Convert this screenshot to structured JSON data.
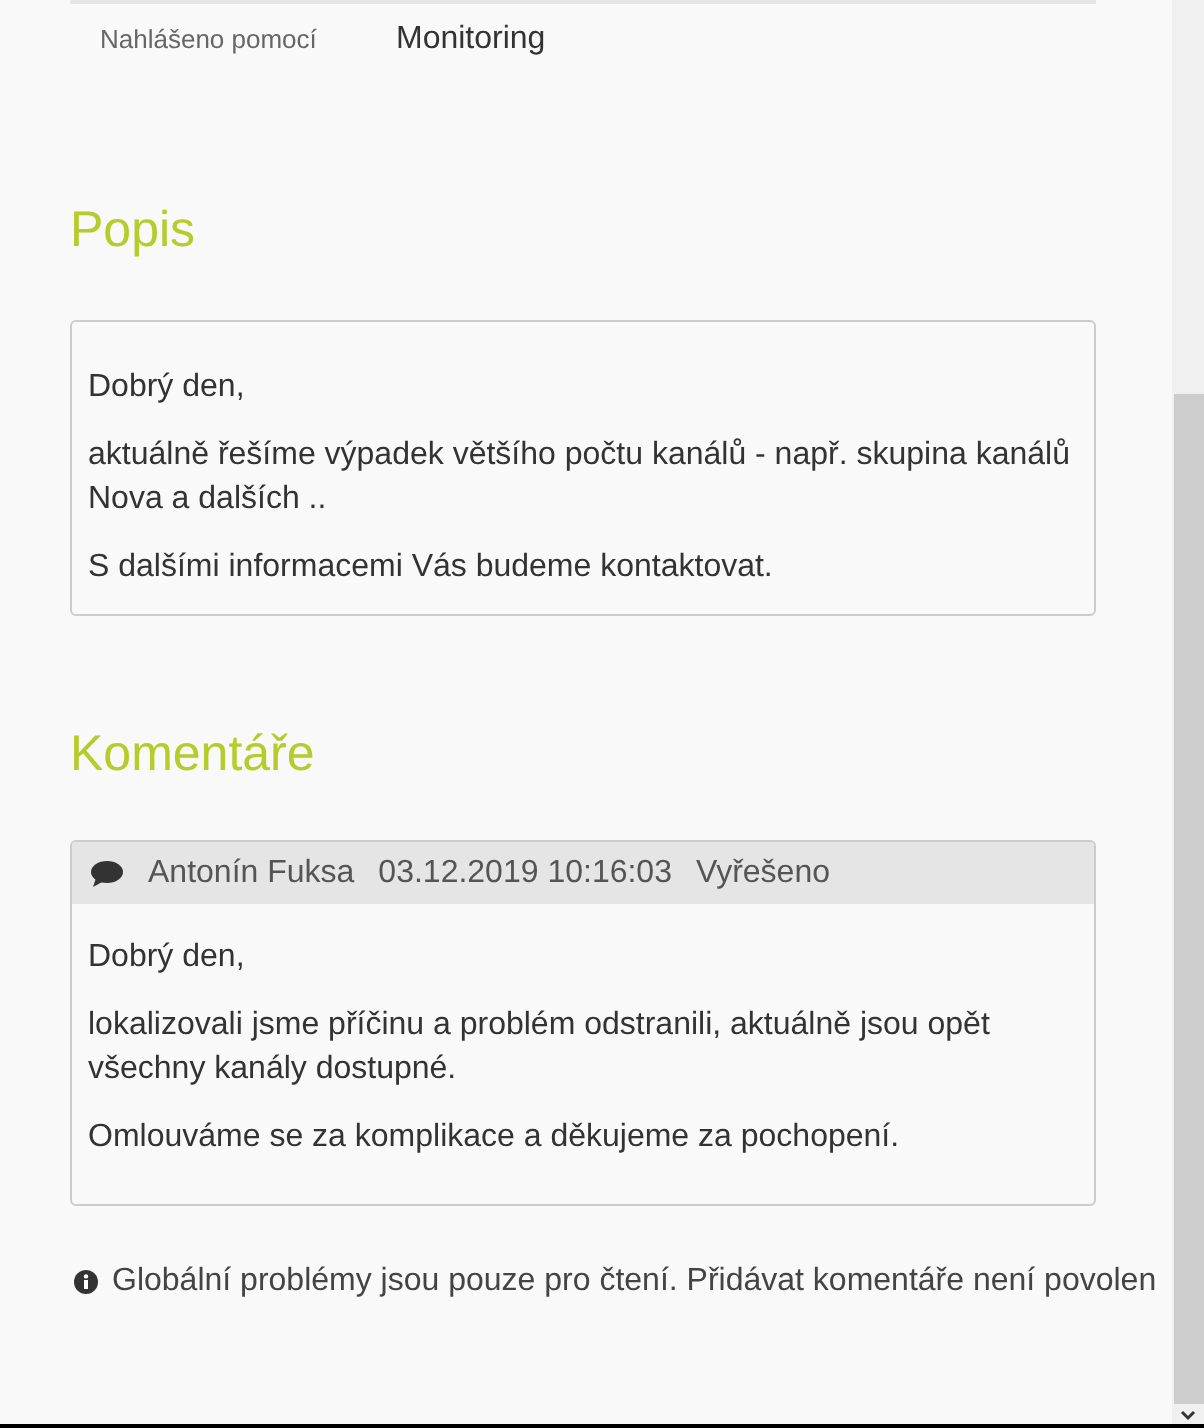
{
  "details": [
    {
      "label": "Nahlášeno pomocí",
      "value": "Monitoring"
    }
  ],
  "description": {
    "title": "Popis",
    "paragraphs": [
      "Dobrý den,",
      "aktuálně řešíme výpadek většího počtu kanálů - např. skupina kanálů Nova a dalších ..",
      "S dalšími informacemi Vás budeme kontaktovat."
    ]
  },
  "comments": {
    "title": "Komentáře",
    "items": [
      {
        "author": "Antonín Fuksa",
        "date": "03.12.2019 10:16:03",
        "status": "Vyřešeno",
        "paragraphs": [
          "Dobrý den,",
          "lokalizovali jsme příčinu a problém odstranili, aktuálně jsou opět všechny kanály dostupné.",
          "Omlouváme se za komplikace a děkujeme za pochopení."
        ]
      }
    ]
  },
  "notice": "Globální problémy jsou pouze pro čtení. Přidávat komentáře není povolen"
}
